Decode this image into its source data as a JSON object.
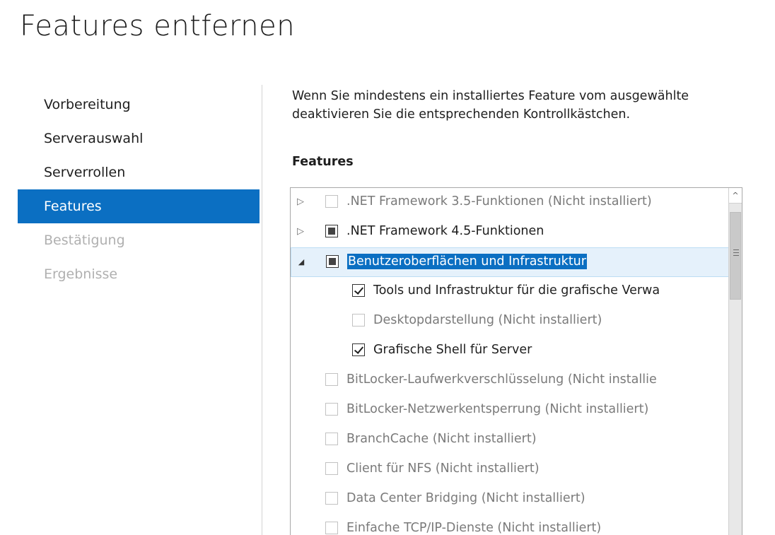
{
  "window": {
    "title": "Features entfernen"
  },
  "nav": {
    "items": [
      {
        "label": "Vorbereitung",
        "state": "normal"
      },
      {
        "label": "Serverauswahl",
        "state": "normal"
      },
      {
        "label": "Serverrollen",
        "state": "normal"
      },
      {
        "label": "Features",
        "state": "active"
      },
      {
        "label": "Bestätigung",
        "state": "disabled"
      },
      {
        "label": "Ergebnisse",
        "state": "disabled"
      }
    ]
  },
  "main": {
    "description_line1": "Wenn Sie mindestens ein installiertes Feature vom ausgewählte",
    "description_line2": "deaktivieren Sie die entsprechenden Kontrollkästchen.",
    "section_label": "Features"
  },
  "features": [
    {
      "label": ".NET Framework 3.5-Funktionen (Nicht installiert)",
      "state": "unchecked",
      "expander": "collapsed",
      "level": 0,
      "enabled": false
    },
    {
      "label": ".NET Framework 4.5-Funktionen",
      "state": "partial",
      "expander": "collapsed",
      "level": 0,
      "enabled": true
    },
    {
      "label": "Benutzeroberflächen und Infrastruktur",
      "state": "partial",
      "expander": "expanded",
      "level": 0,
      "enabled": true,
      "selected": true
    },
    {
      "label": "Tools und Infrastruktur für die grafische Verwa",
      "state": "checked",
      "expander": "none",
      "level": 1,
      "enabled": true
    },
    {
      "label": "Desktopdarstellung (Nicht installiert)",
      "state": "unchecked",
      "expander": "none",
      "level": 1,
      "enabled": false
    },
    {
      "label": "Grafische Shell für Server",
      "state": "checked",
      "expander": "none",
      "level": 1,
      "enabled": true
    },
    {
      "label": "BitLocker-Laufwerkverschlüsselung (Nicht installie",
      "state": "unchecked",
      "expander": "none",
      "level": 0,
      "enabled": false
    },
    {
      "label": "BitLocker-Netzwerkentsperrung (Nicht installiert)",
      "state": "unchecked",
      "expander": "none",
      "level": 0,
      "enabled": false
    },
    {
      "label": "BranchCache (Nicht installiert)",
      "state": "unchecked",
      "expander": "none",
      "level": 0,
      "enabled": false
    },
    {
      "label": "Client für NFS (Nicht installiert)",
      "state": "unchecked",
      "expander": "none",
      "level": 0,
      "enabled": false
    },
    {
      "label": "Data Center Bridging (Nicht installiert)",
      "state": "unchecked",
      "expander": "none",
      "level": 0,
      "enabled": false
    },
    {
      "label": "Einfache TCP/IP-Dienste (Nicht installiert)",
      "state": "unchecked",
      "expander": "none",
      "level": 0,
      "enabled": false
    }
  ],
  "scrollbar": {
    "up_arrow_icon": "chevron-up-icon",
    "thumb_grip_icon": "grip-lines-icon"
  },
  "colors": {
    "accent": "#0b6fc2",
    "selection_bg": "#e5f1fb",
    "disabled_text": "#7a7a7a"
  }
}
